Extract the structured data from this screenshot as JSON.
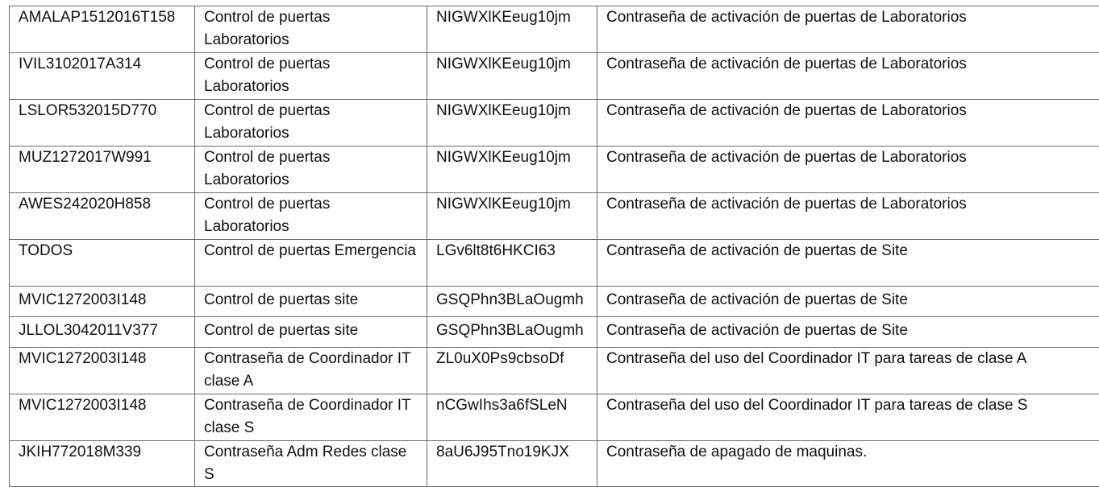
{
  "rows": [
    {
      "user": "AMALAP1512016T158",
      "system": "Control de puertas Laboratorios",
      "password": "NIGWXlKEeug10jm",
      "description": "Contraseña de activación de puertas de Laboratorios"
    },
    {
      "user": "IVIL3102017A314",
      "system": "Control de puertas Laboratorios",
      "password": "NIGWXlKEeug10jm",
      "description": "Contraseña de activación de puertas de Laboratorios"
    },
    {
      "user": "LSLOR532015D770",
      "system": "Control de puertas Laboratorios",
      "password": "NIGWXlKEeug10jm",
      "description": "Contraseña de activación de puertas de Laboratorios"
    },
    {
      "user": "MUZ1272017W991",
      "system": "Control de puertas Laboratorios",
      "password": "NIGWXlKEeug10jm",
      "description": "Contraseña de activación de puertas de Laboratorios"
    },
    {
      "user": "AWES242020H858",
      "system": "Control de puertas Laboratorios",
      "password": "NIGWXlKEeug10jm",
      "description": "Contraseña de activación de puertas de Laboratorios"
    },
    {
      "user": "TODOS",
      "system": "Control de puertas Emergencia",
      "password": "LGv6lt8t6HKCI63",
      "description": "Contraseña de activación de puertas de Site"
    },
    {
      "user": "MVIC1272003I148",
      "system": "Control de puertas site",
      "password": "GSQPhn3BLaOugmh",
      "description": "Contraseña de activación de puertas de Site"
    },
    {
      "user": "JLLOL3042011V377",
      "system": "Control de puertas site",
      "password": "GSQPhn3BLaOugmh",
      "description": "Contraseña de activación de puertas de Site"
    },
    {
      "user": "MVIC1272003I148",
      "system": "Contraseña de Coordinador IT clase A",
      "password": "ZL0uX0Ps9cbsoDf",
      "description": "Contraseña del uso del Coordinador IT para tareas de clase A"
    },
    {
      "user": "MVIC1272003I148",
      "system": "Contraseña de Coordinador IT clase S",
      "password": "nCGwIhs3a6fSLeN",
      "description": "Contraseña del uso del Coordinador IT para tareas de clase S"
    },
    {
      "user": "JKIH772018M339",
      "system": "Contraseña Adm Redes clase S",
      "password": "8aU6J95Tno19KJX",
      "description": "Contraseña de apagado de maquinas."
    }
  ]
}
